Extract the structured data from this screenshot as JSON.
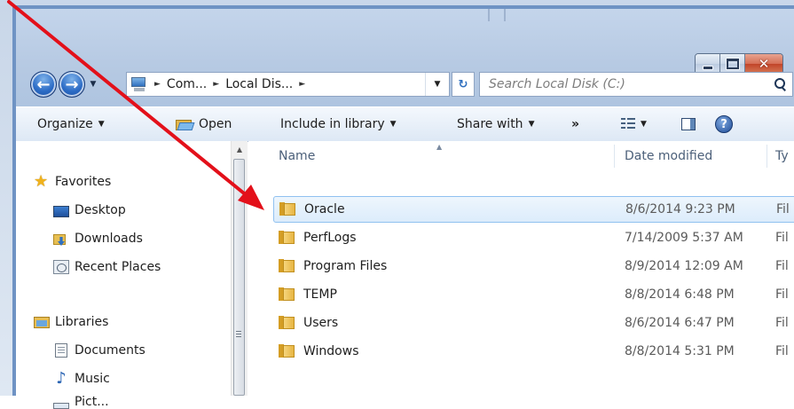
{
  "window": {
    "caption": {
      "minimize": "–",
      "maximize": "□",
      "close": "✕"
    }
  },
  "address": {
    "segments": [
      "Com...",
      "Local Dis..."
    ],
    "separator": "►",
    "search_placeholder": "Search Local Disk (C:)"
  },
  "toolbar": {
    "organize": "Organize",
    "open": "Open",
    "include_in_library": "Include in library",
    "share_with": "Share with",
    "more": "»"
  },
  "navigation": {
    "favorites": {
      "label": "Favorites",
      "items": [
        "Desktop",
        "Downloads",
        "Recent Places"
      ]
    },
    "libraries": {
      "label": "Libraries",
      "items": [
        "Documents",
        "Music",
        "Pict..."
      ]
    }
  },
  "columns": {
    "name": "Name",
    "date_modified": "Date modified",
    "type": "Ty"
  },
  "files": [
    {
      "name": "Oracle",
      "date": "8/6/2014 9:23 PM",
      "type": "Fil",
      "selected": true
    },
    {
      "name": "PerfLogs",
      "date": "7/14/2009 5:37 AM",
      "type": "Fil"
    },
    {
      "name": "Program Files",
      "date": "8/9/2014 12:09 AM",
      "type": "Fil"
    },
    {
      "name": "TEMP",
      "date": "8/8/2014 6:48 PM",
      "type": "Fil"
    },
    {
      "name": "Users",
      "date": "8/6/2014 6:47 PM",
      "type": "Fil"
    },
    {
      "name": "Windows",
      "date": "8/8/2014 5:31 PM",
      "type": "Fil"
    }
  ],
  "colors": {
    "annotation_arrow": "#e3101a",
    "window_border": "#6f93c4",
    "selection_border": "#90c1f0"
  }
}
